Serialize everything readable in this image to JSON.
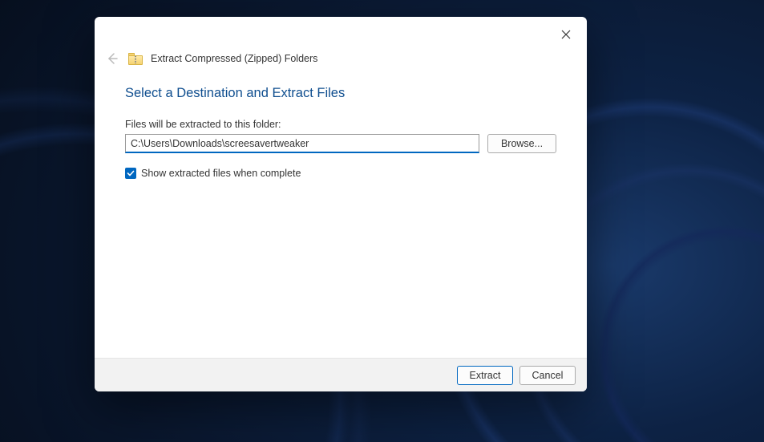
{
  "header": {
    "title": "Extract Compressed (Zipped) Folders"
  },
  "content": {
    "heading": "Select a Destination and Extract Files",
    "field_label": "Files will be extracted to this folder:",
    "path_value": "C:\\Users\\Downloads\\screesavertweaker",
    "browse_label": "Browse...",
    "checkbox_label": "Show extracted files when complete",
    "checkbox_checked": true
  },
  "footer": {
    "extract_label": "Extract",
    "cancel_label": "Cancel"
  }
}
